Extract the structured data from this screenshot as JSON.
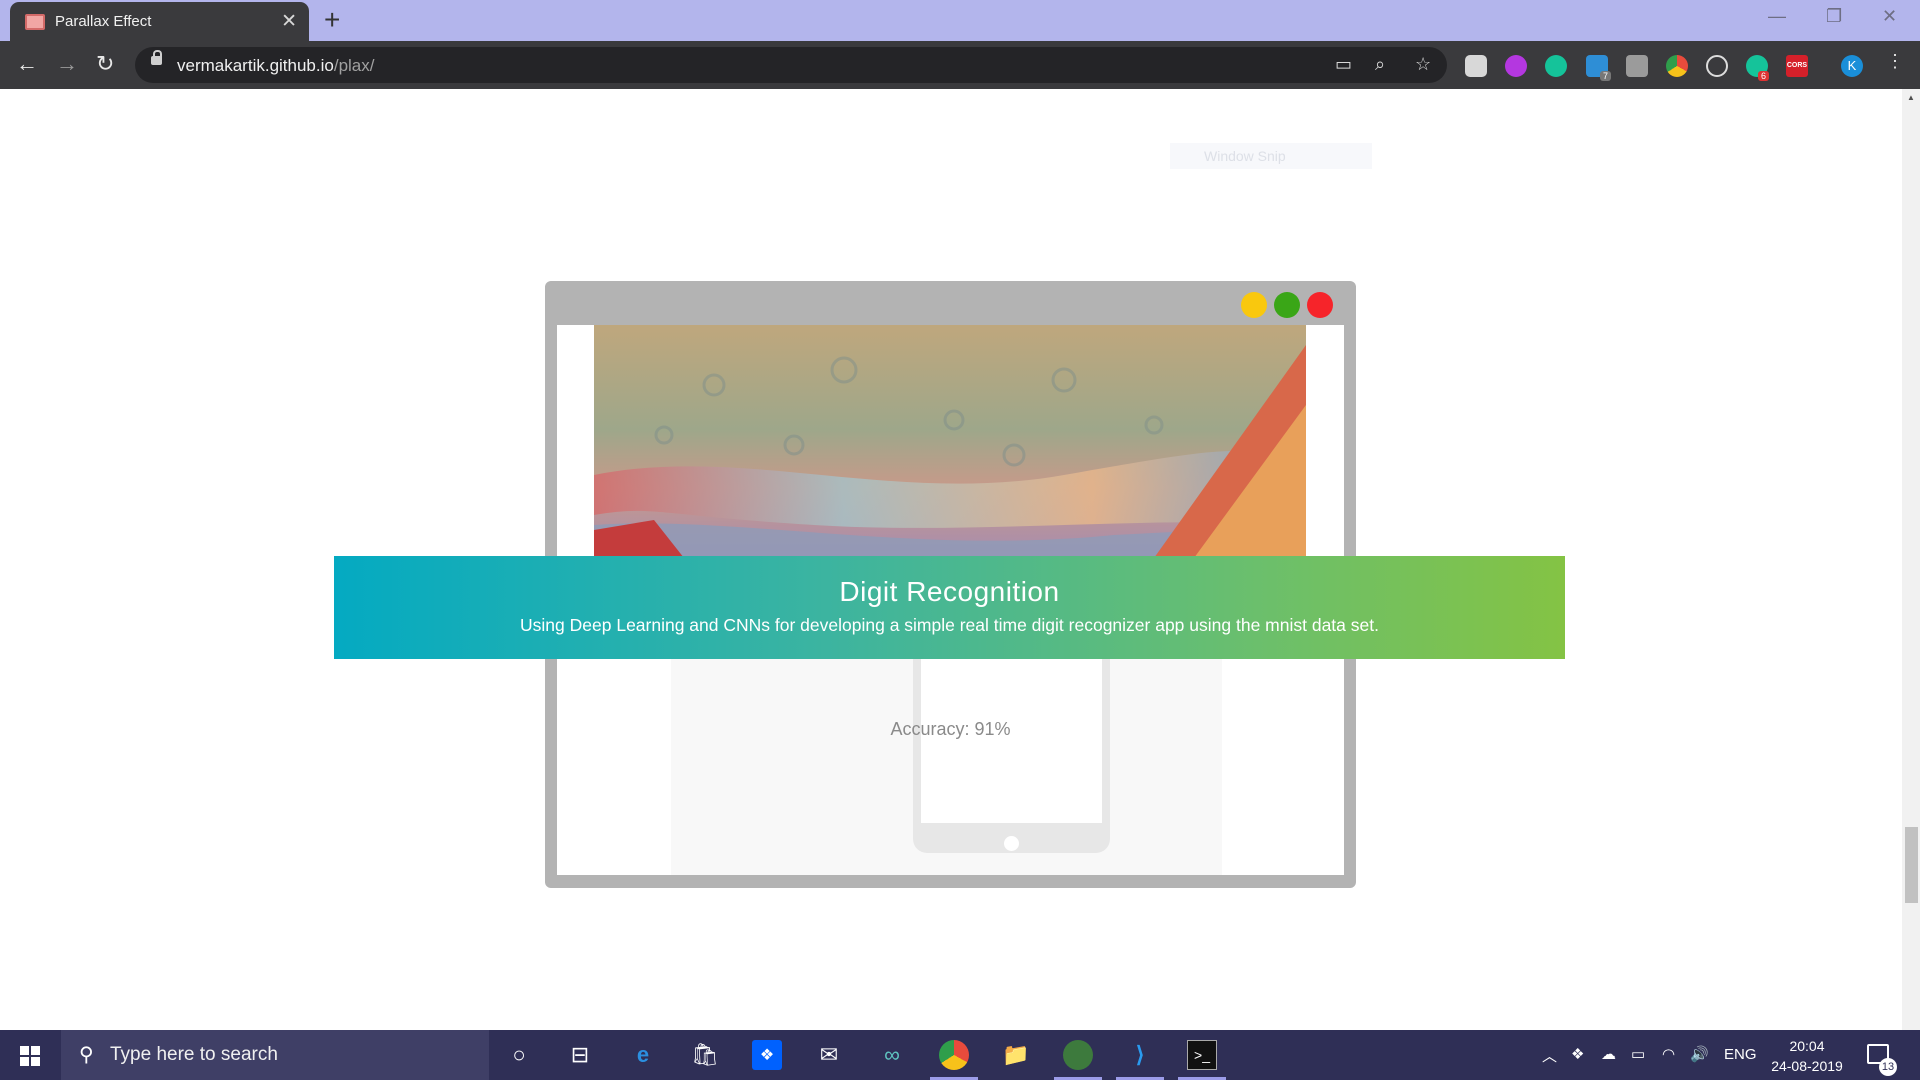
{
  "browser": {
    "tab_title": "Parallax Effect",
    "tab_close": "✕",
    "new_tab": "+",
    "url_host": "vermakartik.github.io",
    "url_path": "/plax/",
    "profile_initial": "K",
    "extension_badges": {
      "linkedin": "7",
      "grammarly_alt": "6",
      "cors": "CORS"
    }
  },
  "page": {
    "window_snip": "Window Snip",
    "banner_title": "Digit Recognition",
    "banner_subtitle": "Using Deep Learning and CNNs for developing a simple real time digit recognizer app using the mnist data set.",
    "accuracy": "Accuracy: 91%",
    "mock_window_dots": [
      "#f9c80e",
      "#3aa617",
      "#f6242a"
    ]
  },
  "taskbar": {
    "search_placeholder": "Type here to search",
    "language": "ENG",
    "time": "20:04",
    "date": "24-08-2019",
    "notification_count": "13"
  },
  "colors": {
    "banner_gradient": [
      "#04aac2",
      "#84c344"
    ],
    "tabstrip": "#b3b5ec",
    "toolbar": "#3a3a3d",
    "taskbar": "#2f2f56"
  }
}
